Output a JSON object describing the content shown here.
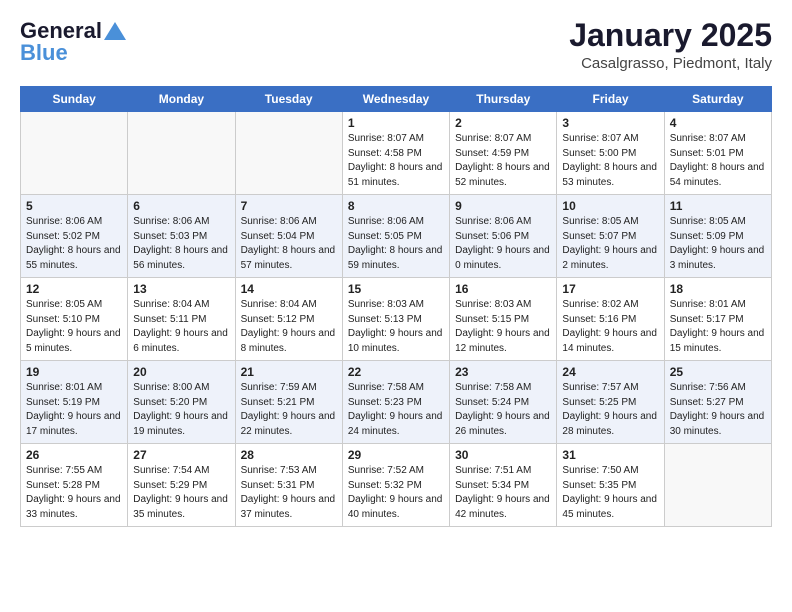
{
  "logo": {
    "part1": "General",
    "part2": "Blue"
  },
  "header": {
    "month": "January 2025",
    "location": "Casalgrasso, Piedmont, Italy"
  },
  "weekdays": [
    "Sunday",
    "Monday",
    "Tuesday",
    "Wednesday",
    "Thursday",
    "Friday",
    "Saturday"
  ],
  "weeks": [
    [
      {
        "day": "",
        "info": ""
      },
      {
        "day": "",
        "info": ""
      },
      {
        "day": "",
        "info": ""
      },
      {
        "day": "1",
        "info": "Sunrise: 8:07 AM\nSunset: 4:58 PM\nDaylight: 8 hours\nand 51 minutes."
      },
      {
        "day": "2",
        "info": "Sunrise: 8:07 AM\nSunset: 4:59 PM\nDaylight: 8 hours\nand 52 minutes."
      },
      {
        "day": "3",
        "info": "Sunrise: 8:07 AM\nSunset: 5:00 PM\nDaylight: 8 hours\nand 53 minutes."
      },
      {
        "day": "4",
        "info": "Sunrise: 8:07 AM\nSunset: 5:01 PM\nDaylight: 8 hours\nand 54 minutes."
      }
    ],
    [
      {
        "day": "5",
        "info": "Sunrise: 8:06 AM\nSunset: 5:02 PM\nDaylight: 8 hours\nand 55 minutes."
      },
      {
        "day": "6",
        "info": "Sunrise: 8:06 AM\nSunset: 5:03 PM\nDaylight: 8 hours\nand 56 minutes."
      },
      {
        "day": "7",
        "info": "Sunrise: 8:06 AM\nSunset: 5:04 PM\nDaylight: 8 hours\nand 57 minutes."
      },
      {
        "day": "8",
        "info": "Sunrise: 8:06 AM\nSunset: 5:05 PM\nDaylight: 8 hours\nand 59 minutes."
      },
      {
        "day": "9",
        "info": "Sunrise: 8:06 AM\nSunset: 5:06 PM\nDaylight: 9 hours\nand 0 minutes."
      },
      {
        "day": "10",
        "info": "Sunrise: 8:05 AM\nSunset: 5:07 PM\nDaylight: 9 hours\nand 2 minutes."
      },
      {
        "day": "11",
        "info": "Sunrise: 8:05 AM\nSunset: 5:09 PM\nDaylight: 9 hours\nand 3 minutes."
      }
    ],
    [
      {
        "day": "12",
        "info": "Sunrise: 8:05 AM\nSunset: 5:10 PM\nDaylight: 9 hours\nand 5 minutes."
      },
      {
        "day": "13",
        "info": "Sunrise: 8:04 AM\nSunset: 5:11 PM\nDaylight: 9 hours\nand 6 minutes."
      },
      {
        "day": "14",
        "info": "Sunrise: 8:04 AM\nSunset: 5:12 PM\nDaylight: 9 hours\nand 8 minutes."
      },
      {
        "day": "15",
        "info": "Sunrise: 8:03 AM\nSunset: 5:13 PM\nDaylight: 9 hours\nand 10 minutes."
      },
      {
        "day": "16",
        "info": "Sunrise: 8:03 AM\nSunset: 5:15 PM\nDaylight: 9 hours\nand 12 minutes."
      },
      {
        "day": "17",
        "info": "Sunrise: 8:02 AM\nSunset: 5:16 PM\nDaylight: 9 hours\nand 14 minutes."
      },
      {
        "day": "18",
        "info": "Sunrise: 8:01 AM\nSunset: 5:17 PM\nDaylight: 9 hours\nand 15 minutes."
      }
    ],
    [
      {
        "day": "19",
        "info": "Sunrise: 8:01 AM\nSunset: 5:19 PM\nDaylight: 9 hours\nand 17 minutes."
      },
      {
        "day": "20",
        "info": "Sunrise: 8:00 AM\nSunset: 5:20 PM\nDaylight: 9 hours\nand 19 minutes."
      },
      {
        "day": "21",
        "info": "Sunrise: 7:59 AM\nSunset: 5:21 PM\nDaylight: 9 hours\nand 22 minutes."
      },
      {
        "day": "22",
        "info": "Sunrise: 7:58 AM\nSunset: 5:23 PM\nDaylight: 9 hours\nand 24 minutes."
      },
      {
        "day": "23",
        "info": "Sunrise: 7:58 AM\nSunset: 5:24 PM\nDaylight: 9 hours\nand 26 minutes."
      },
      {
        "day": "24",
        "info": "Sunrise: 7:57 AM\nSunset: 5:25 PM\nDaylight: 9 hours\nand 28 minutes."
      },
      {
        "day": "25",
        "info": "Sunrise: 7:56 AM\nSunset: 5:27 PM\nDaylight: 9 hours\nand 30 minutes."
      }
    ],
    [
      {
        "day": "26",
        "info": "Sunrise: 7:55 AM\nSunset: 5:28 PM\nDaylight: 9 hours\nand 33 minutes."
      },
      {
        "day": "27",
        "info": "Sunrise: 7:54 AM\nSunset: 5:29 PM\nDaylight: 9 hours\nand 35 minutes."
      },
      {
        "day": "28",
        "info": "Sunrise: 7:53 AM\nSunset: 5:31 PM\nDaylight: 9 hours\nand 37 minutes."
      },
      {
        "day": "29",
        "info": "Sunrise: 7:52 AM\nSunset: 5:32 PM\nDaylight: 9 hours\nand 40 minutes."
      },
      {
        "day": "30",
        "info": "Sunrise: 7:51 AM\nSunset: 5:34 PM\nDaylight: 9 hours\nand 42 minutes."
      },
      {
        "day": "31",
        "info": "Sunrise: 7:50 AM\nSunset: 5:35 PM\nDaylight: 9 hours\nand 45 minutes."
      },
      {
        "day": "",
        "info": ""
      }
    ]
  ]
}
